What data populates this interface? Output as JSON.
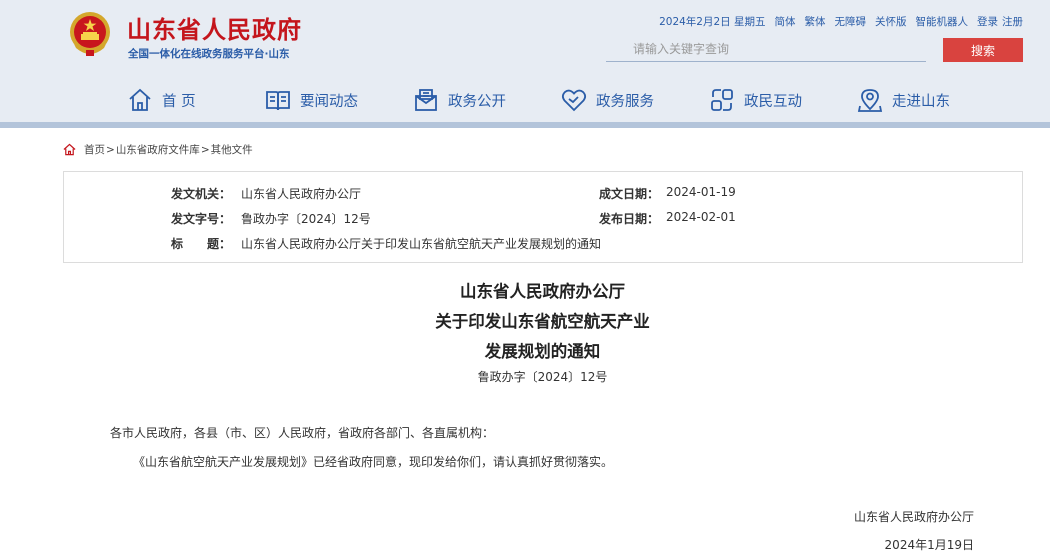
{
  "header": {
    "site_title": "山东省人民政府",
    "site_subtitle": "全国一体化在线政务服务平台·山东",
    "emblem_icon": "national-emblem-icon",
    "brand_color": "#c4151c",
    "accent_color": "#2b5da8",
    "top_links": {
      "date": "2024年2月2日 星期五",
      "simplified": "简体",
      "traditional": "繁体",
      "accessibility": "无障碍",
      "care": "关怀版",
      "robot": "智能机器人",
      "login": "登录",
      "register": "注册"
    },
    "search": {
      "placeholder": "请输入关键字查询",
      "button_label": "搜索",
      "button_color": "#d9433f"
    }
  },
  "nav": {
    "items": [
      {
        "label": "首 页",
        "icon": "home-icon"
      },
      {
        "label": "要闻动态",
        "icon": "news-book-icon"
      },
      {
        "label": "政务公开",
        "icon": "open-affairs-icon"
      },
      {
        "label": "政务服务",
        "icon": "heart-service-icon"
      },
      {
        "label": "政民互动",
        "icon": "interaction-icon"
      },
      {
        "label": "走进山东",
        "icon": "location-pin-icon"
      }
    ]
  },
  "breadcrumb": {
    "icon": "home-outline-icon",
    "items": [
      "首页",
      "山东省政府文件库",
      "其他文件"
    ],
    "separator": ">"
  },
  "meta": {
    "issuer_label": "发文机关：",
    "issuer": "山东省人民政府办公厅",
    "doc_no_label": "发文字号：",
    "doc_no": "鲁政办字〔2024〕12号",
    "title_label": "标　　题：",
    "title": "山东省人民政府办公厅关于印发山东省航空航天产业发展规划的通知",
    "created_label": "成文日期：",
    "created": "2024-01-19",
    "published_label": "发布日期：",
    "published": "2024-02-01"
  },
  "document": {
    "title_line1": "山东省人民政府办公厅",
    "title_line2": "关于印发山东省航空航天产业",
    "title_line3": "发展规划的通知",
    "number": "鲁政办字〔2024〕12号",
    "salutation": "各市人民政府，各县（市、区）人民政府，省政府各部门、各直属机构：",
    "body": "《山东省航空航天产业发展规划》已经省政府同意，现印发给你们，请认真抓好贯彻落实。",
    "signer": "山东省人民政府办公厅",
    "sign_date": "2024年1月19日"
  }
}
